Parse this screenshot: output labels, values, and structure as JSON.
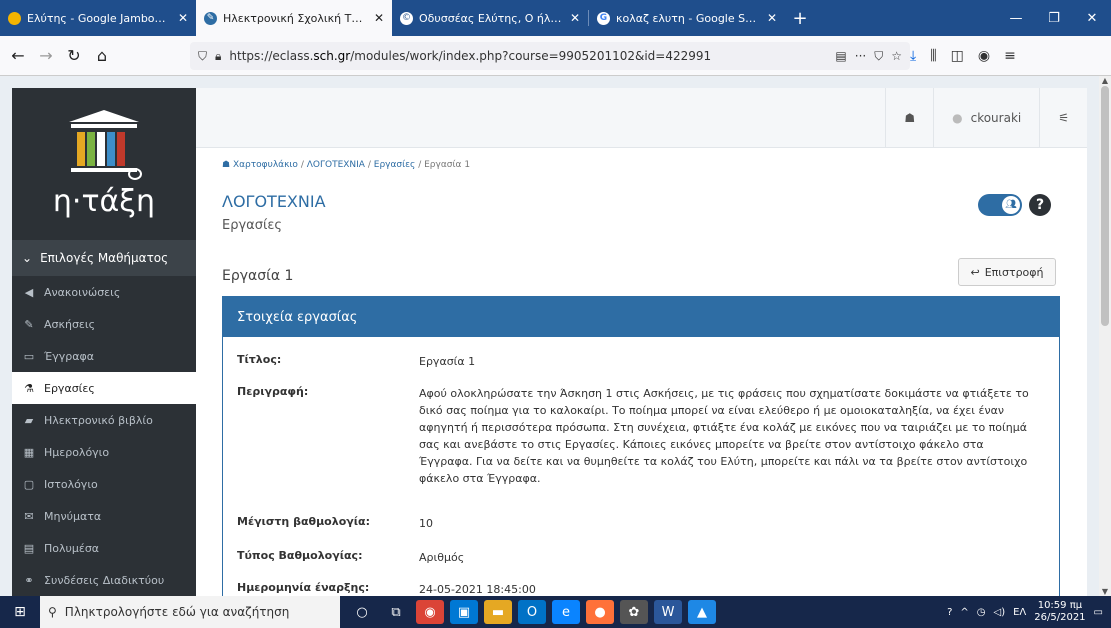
{
  "browser": {
    "tabs": [
      {
        "title": "Ελύτης - Google Jamboard",
        "favicon": "jamboard-icon",
        "active": false
      },
      {
        "title": "Ηλεκτρονική Σχολική Τάξη (η-",
        "favicon": "eclass-icon",
        "active": true
      },
      {
        "title": "Οδυσσέας Ελύτης, Ο ήλιος ο ηλ",
        "favicon": "site-icon",
        "active": false
      },
      {
        "title": "κολαζ ελυτη - Google Search",
        "favicon": "google-icon",
        "active": false
      }
    ],
    "url_prefix": "https://eclass.",
    "url_domain": "sch.gr",
    "url_suffix": "/modules/work/index.php?course=9905201102&id=422991"
  },
  "sidebar": {
    "logo_text": "η·τάξη",
    "header": "Επιλογές Μαθήματος",
    "items": [
      {
        "label": "Ανακοινώσεις",
        "icon": "megaphone-icon",
        "glyph": "✉"
      },
      {
        "label": "Ασκήσεις",
        "icon": "pencil-icon",
        "glyph": "✎"
      },
      {
        "label": "Έγγραφα",
        "icon": "folder-icon",
        "glyph": "▭"
      },
      {
        "label": "Εργασίες",
        "icon": "flask-icon",
        "glyph": "⚗"
      },
      {
        "label": "Ηλεκτρονικό βιβλίο",
        "icon": "book-icon",
        "glyph": "▰"
      },
      {
        "label": "Ημερολόγιο",
        "icon": "calendar-icon",
        "glyph": "▦"
      },
      {
        "label": "Ιστολόγιο",
        "icon": "blog-icon",
        "glyph": "▢"
      },
      {
        "label": "Μηνύματα",
        "icon": "envelope-icon",
        "glyph": "✉"
      },
      {
        "label": "Πολυμέσα",
        "icon": "film-icon",
        "glyph": "▤"
      },
      {
        "label": "Συνδέσεις Διαδικτύου",
        "icon": "link-icon",
        "glyph": "⚭"
      }
    ]
  },
  "topbar": {
    "username": "ckouraki"
  },
  "breadcrumb": {
    "home": "Χαρτοφυλάκιο",
    "course": "ΛΟΓΟΤΕΧΝΙΑ",
    "section": "Εργασίες",
    "current": "Εργασία 1",
    "sep": "/"
  },
  "course_title": "ΛΟΓΟΤΕΧΝΙΑ",
  "section_title": "Εργασίες",
  "page_title": "Εργασία 1",
  "back_button": "Επιστροφή",
  "panel": {
    "heading": "Στοιχεία εργασίας",
    "rows": [
      {
        "label": "Τίτλος:",
        "value": "Εργασία 1"
      },
      {
        "label": "Περιγραφή:",
        "value": "Αφού ολοκληρώσατε την Άσκηση 1 στις Ασκήσεις, με τις φράσεις που σχηματίσατε δοκιμάστε να φτιάξετε το δικό σας ποίημα για το καλοκαίρι. Το ποίημα μπορεί να είναι ελεύθερο ή με ομοιοκαταληξία, να έχει έναν αφηγητή ή περισσότερα πρόσωπα. Στη συνέχεια, φτιάξτε ένα κολάζ με εικόνες που να ταιριάζει με το ποίημά σας και ανεβάστε το στις Εργασίες. Κάποιες εικόνες μπορείτε να βρείτε στον αντίστοιχο φάκελο στα Έγγραφα. Για να δείτε και να θυμηθείτε τα κολάζ του Ελύτη, μπορείτε και πάλι να τα βρείτε στον αντίστοιχο φάκελο στα Έγγραφα."
      },
      {
        "label": "Μέγιστη βαθμολογία:",
        "value": "10"
      },
      {
        "label": "Τύπος Βαθμολογίας:",
        "value": "Αριθμός"
      },
      {
        "label": "Ημερομηνία έναρξης:",
        "value": "24-05-2021 18:45:00"
      }
    ]
  },
  "taskbar": {
    "search_placeholder": "Πληκτρολογήστε εδώ για αναζήτηση",
    "lang": "ΕΛ",
    "time": "10:59 πμ",
    "date": "26/5/2021"
  },
  "colors": {
    "accent": "#2e6da4",
    "sidebar": "#2c3136",
    "tabbar": "#1f4e8c"
  }
}
